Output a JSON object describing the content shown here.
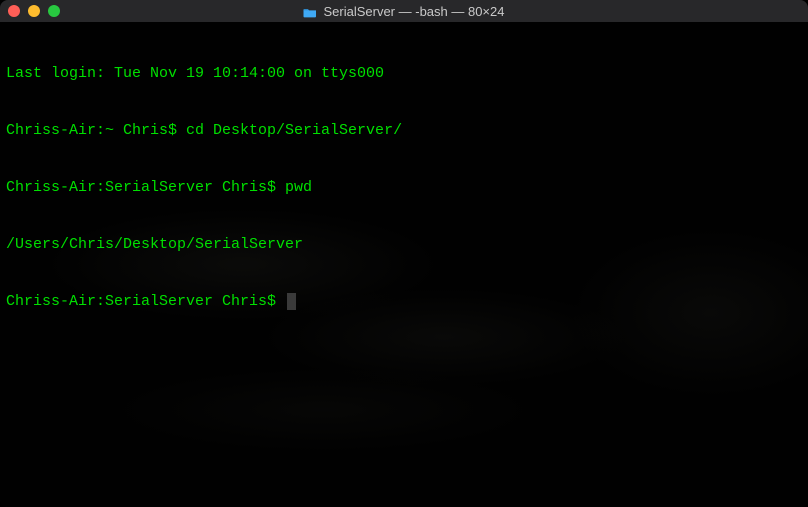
{
  "titlebar": {
    "folder_icon": "folder-icon",
    "title": "SerialServer — -bash — 80×24"
  },
  "terminal": {
    "lines": [
      {
        "prompt": "",
        "text": "Last login: Tue Nov 19 10:14:00 on ttys000"
      },
      {
        "prompt": "Chriss-Air:~ Chris$ ",
        "text": "cd Desktop/SerialServer/"
      },
      {
        "prompt": "Chriss-Air:SerialServer Chris$ ",
        "text": "pwd"
      },
      {
        "prompt": "",
        "text": "/Users/Chris/Desktop/SerialServer"
      },
      {
        "prompt": "Chriss-Air:SerialServer Chris$ ",
        "text": ""
      }
    ]
  },
  "colors": {
    "text": "#00e000",
    "background": "#000000"
  }
}
